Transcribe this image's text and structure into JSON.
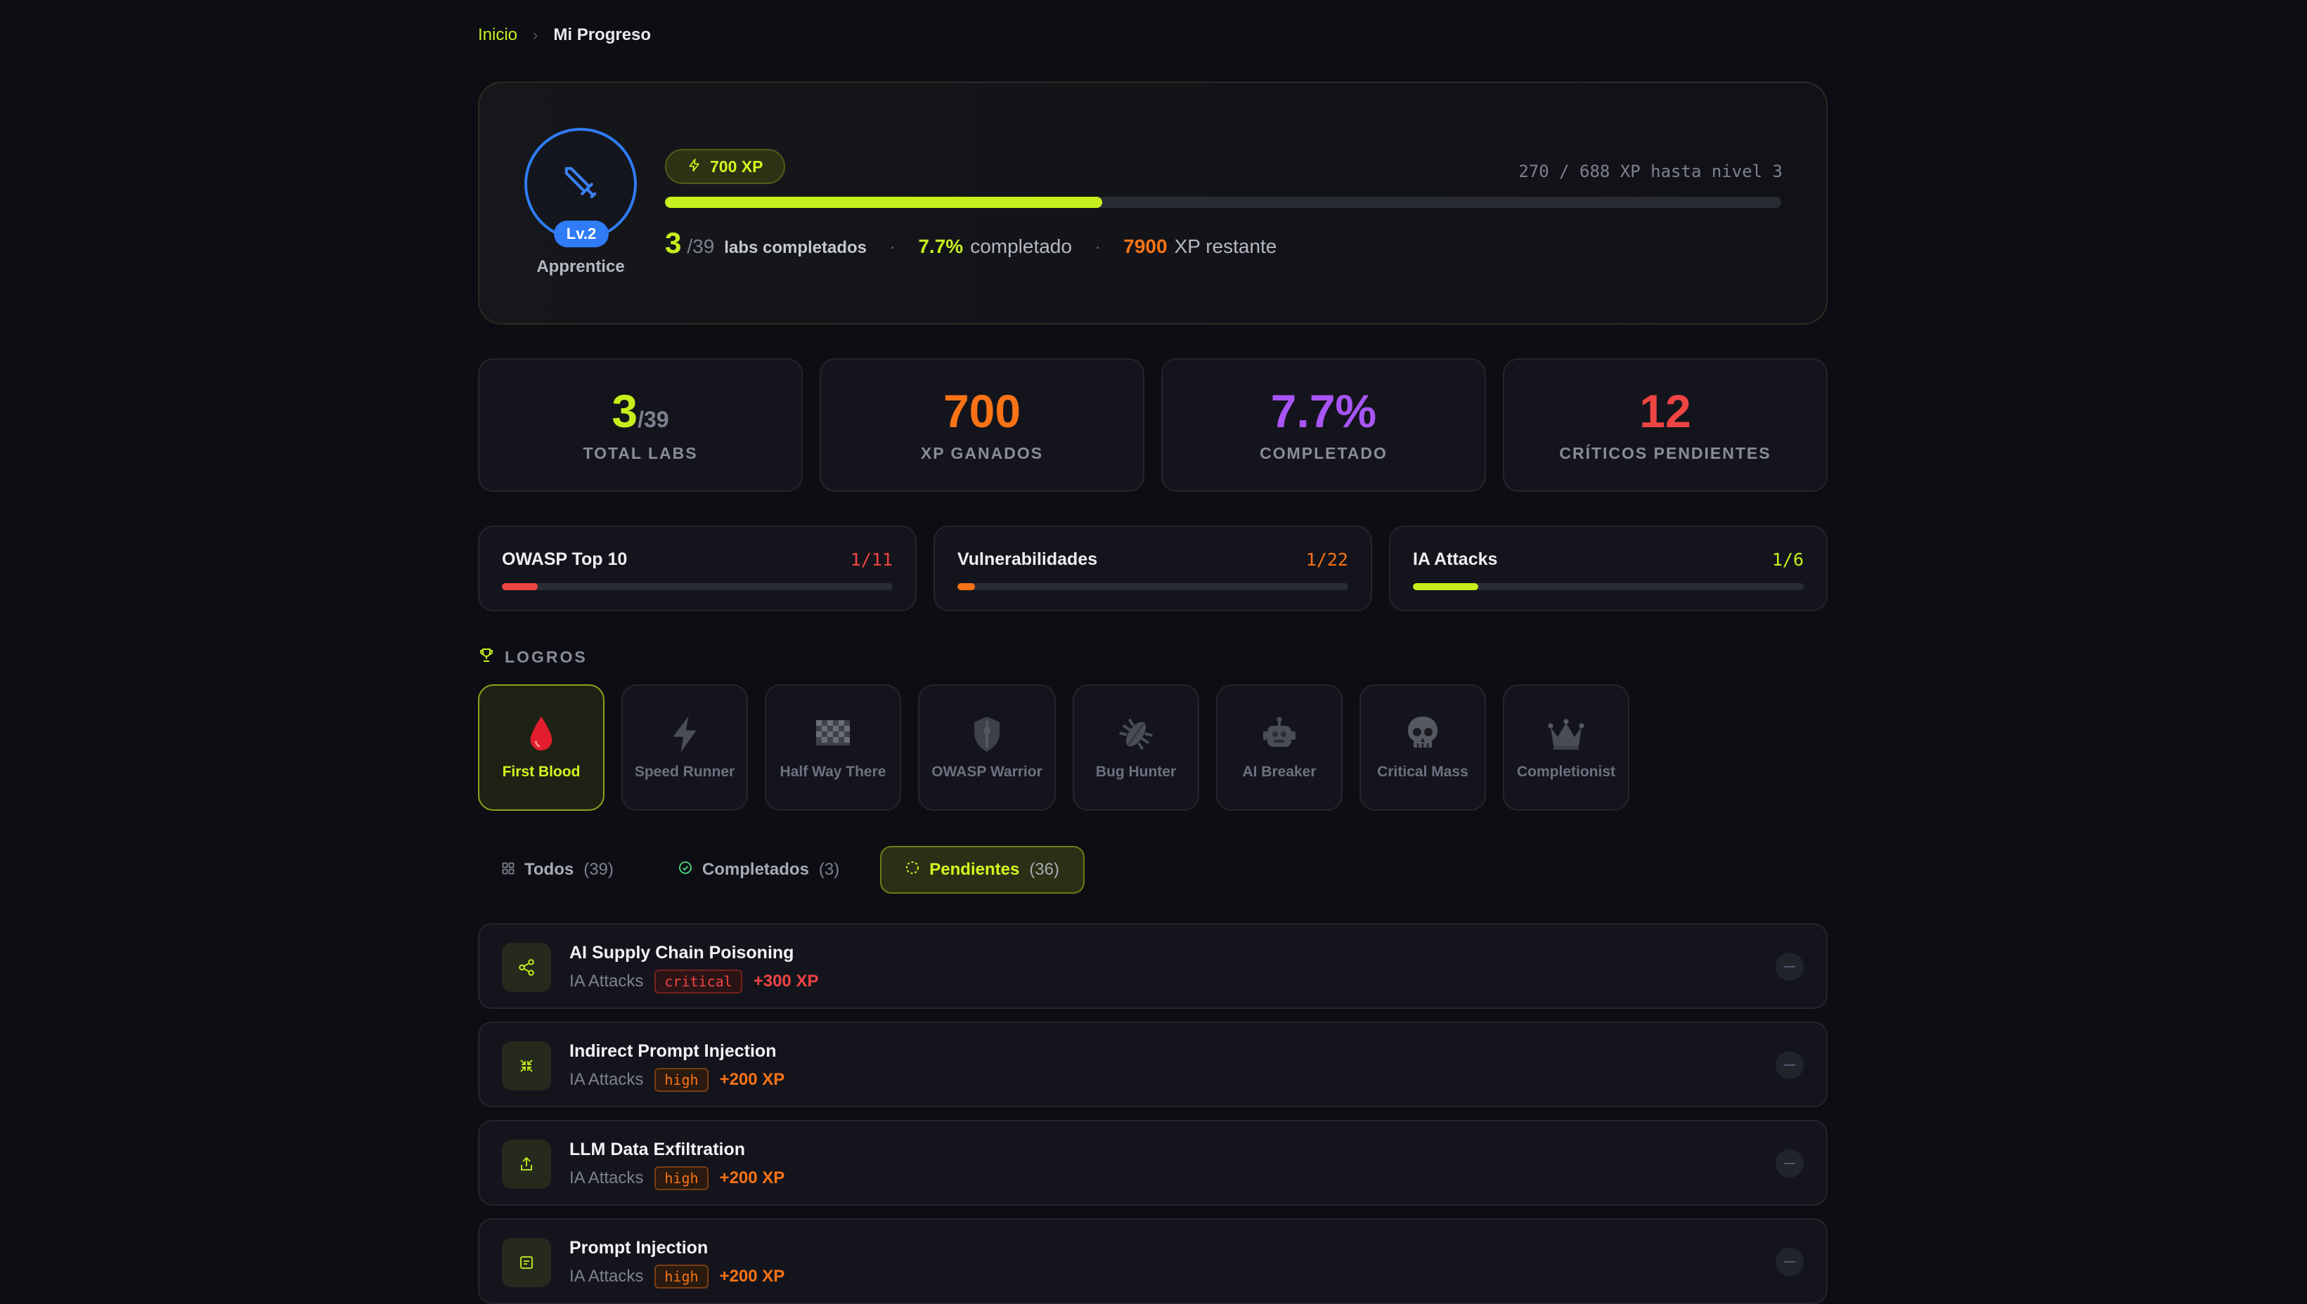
{
  "breadcrumb": {
    "home": "Inicio",
    "separator": "›",
    "current": "Mi Progreso"
  },
  "hero": {
    "level_badge": "Lv.2",
    "rank": "Apprentice",
    "xp_pill": "700 XP",
    "xp_until": "270 / 688 XP hasta nivel 3",
    "xp_progress_fraction": 0.392,
    "labs_done": "3",
    "labs_total": "/39",
    "labs_label": "labs completados",
    "pct_value": "7.7%",
    "pct_label": "completado",
    "remaining_value": "7900",
    "remaining_label": "XP restante",
    "dot": "·"
  },
  "stats": [
    {
      "value": "3",
      "denom": "/39",
      "label": "TOTAL LABS",
      "color": "#c6f01d"
    },
    {
      "value": "700",
      "denom": "",
      "label": "XP GANADOS",
      "color": "#f97316"
    },
    {
      "value": "7.7%",
      "denom": "",
      "label": "COMPLETADO",
      "color": "#a855f7"
    },
    {
      "value": "12",
      "denom": "",
      "label": "CRÍTICOS PENDIENTES",
      "color": "#ef4444"
    }
  ],
  "categories": [
    {
      "name": "OWASP Top 10",
      "count": "1/11",
      "fraction": 0.091,
      "color": "#ef4444"
    },
    {
      "name": "Vulnerabilidades",
      "count": "1/22",
      "fraction": 0.045,
      "color": "#f97316"
    },
    {
      "name": "IA Attacks",
      "count": "1/6",
      "fraction": 0.167,
      "color": "#c6f01d"
    }
  ],
  "achievements_title": "LOGROS",
  "achievements": [
    {
      "label": "First Blood",
      "icon": "blood-drop-icon",
      "unlocked": true
    },
    {
      "label": "Speed Runner",
      "icon": "lightning-icon",
      "unlocked": false
    },
    {
      "label": "Half Way There",
      "icon": "checkered-flag-icon",
      "unlocked": false
    },
    {
      "label": "OWASP Warrior",
      "icon": "shield-icon",
      "unlocked": false
    },
    {
      "label": "Bug Hunter",
      "icon": "bug-icon",
      "unlocked": false
    },
    {
      "label": "AI Breaker",
      "icon": "robot-icon",
      "unlocked": false
    },
    {
      "label": "Critical Mass",
      "icon": "skull-icon",
      "unlocked": false
    },
    {
      "label": "Completionist",
      "icon": "crown-icon",
      "unlocked": false
    }
  ],
  "tabs": [
    {
      "label": "Todos",
      "count": "(39)",
      "icon": "grid-icon",
      "active": false
    },
    {
      "label": "Completados",
      "count": "(3)",
      "icon": "check-circle-icon",
      "active": false
    },
    {
      "label": "Pendientes",
      "count": "(36)",
      "icon": "dashed-circle-icon",
      "active": true
    }
  ],
  "labs": [
    {
      "title": "AI Supply Chain Poisoning",
      "category": "IA Attacks",
      "severity": "critical",
      "xp": "+300 XP",
      "icon": "share-icon"
    },
    {
      "title": "Indirect Prompt Injection",
      "category": "IA Attacks",
      "severity": "high",
      "xp": "+200 XP",
      "icon": "collapse-arrows-icon"
    },
    {
      "title": "LLM Data Exfiltration",
      "category": "IA Attacks",
      "severity": "high",
      "xp": "+200 XP",
      "icon": "upload-icon"
    },
    {
      "title": "Prompt Injection",
      "category": "IA Attacks",
      "severity": "high",
      "xp": "+200 XP",
      "icon": "terminal-icon"
    }
  ]
}
